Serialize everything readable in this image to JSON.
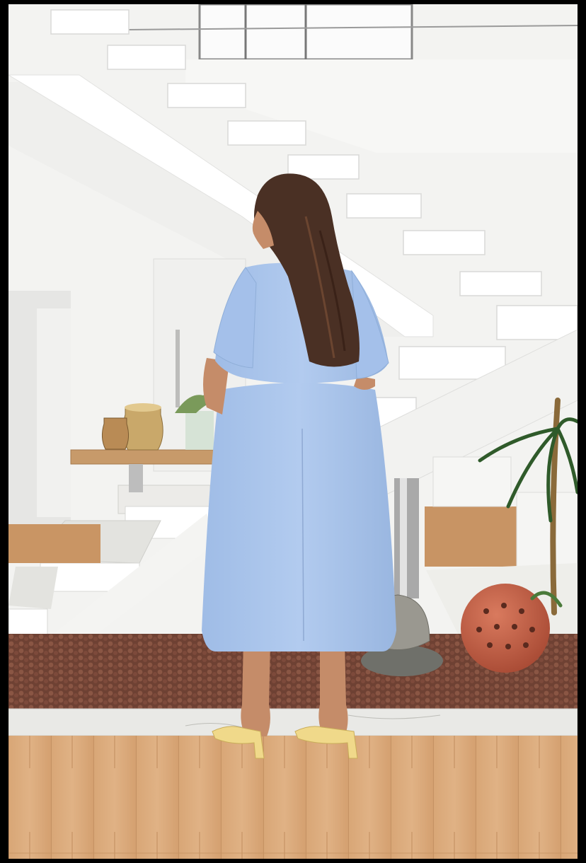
{
  "image": {
    "kind": "photograph",
    "colors": {
      "frame": "#000000",
      "wall": "#f4f4f2",
      "stairs": "#ffffff",
      "marble": "#e9e9e6",
      "floor_wood": "#d9a97a",
      "pebbles": "#7a4a3a",
      "dress": "#a9c4ea",
      "hair": "#4a3024",
      "skin": "#c98f6d",
      "sandals": "#f0d98a",
      "terracotta_ball": "#c8654b",
      "palm": "#2f5a2a",
      "brass": "#c9a86a"
    }
  }
}
